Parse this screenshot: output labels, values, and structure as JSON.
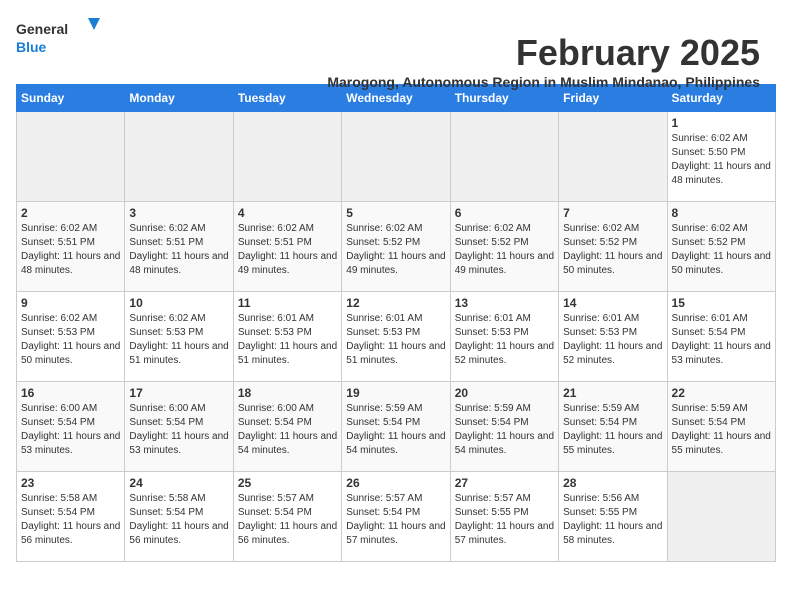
{
  "header": {
    "logo_general": "General",
    "logo_blue": "Blue",
    "month_title": "February 2025",
    "location": "Marogong, Autonomous Region in Muslim Mindanao, Philippines"
  },
  "days_of_week": [
    "Sunday",
    "Monday",
    "Tuesday",
    "Wednesday",
    "Thursday",
    "Friday",
    "Saturday"
  ],
  "weeks": [
    {
      "days": [
        {
          "num": "",
          "empty": true
        },
        {
          "num": "",
          "empty": true
        },
        {
          "num": "",
          "empty": true
        },
        {
          "num": "",
          "empty": true
        },
        {
          "num": "",
          "empty": true
        },
        {
          "num": "",
          "empty": true
        },
        {
          "num": "1",
          "sunrise": "6:02 AM",
          "sunset": "5:50 PM",
          "daylight": "11 hours and 48 minutes."
        }
      ]
    },
    {
      "days": [
        {
          "num": "2",
          "sunrise": "6:02 AM",
          "sunset": "5:51 PM",
          "daylight": "11 hours and 48 minutes."
        },
        {
          "num": "3",
          "sunrise": "6:02 AM",
          "sunset": "5:51 PM",
          "daylight": "11 hours and 48 minutes."
        },
        {
          "num": "4",
          "sunrise": "6:02 AM",
          "sunset": "5:51 PM",
          "daylight": "11 hours and 49 minutes."
        },
        {
          "num": "5",
          "sunrise": "6:02 AM",
          "sunset": "5:52 PM",
          "daylight": "11 hours and 49 minutes."
        },
        {
          "num": "6",
          "sunrise": "6:02 AM",
          "sunset": "5:52 PM",
          "daylight": "11 hours and 49 minutes."
        },
        {
          "num": "7",
          "sunrise": "6:02 AM",
          "sunset": "5:52 PM",
          "daylight": "11 hours and 50 minutes."
        },
        {
          "num": "8",
          "sunrise": "6:02 AM",
          "sunset": "5:52 PM",
          "daylight": "11 hours and 50 minutes."
        }
      ]
    },
    {
      "days": [
        {
          "num": "9",
          "sunrise": "6:02 AM",
          "sunset": "5:53 PM",
          "daylight": "11 hours and 50 minutes."
        },
        {
          "num": "10",
          "sunrise": "6:02 AM",
          "sunset": "5:53 PM",
          "daylight": "11 hours and 51 minutes."
        },
        {
          "num": "11",
          "sunrise": "6:01 AM",
          "sunset": "5:53 PM",
          "daylight": "11 hours and 51 minutes."
        },
        {
          "num": "12",
          "sunrise": "6:01 AM",
          "sunset": "5:53 PM",
          "daylight": "11 hours and 51 minutes."
        },
        {
          "num": "13",
          "sunrise": "6:01 AM",
          "sunset": "5:53 PM",
          "daylight": "11 hours and 52 minutes."
        },
        {
          "num": "14",
          "sunrise": "6:01 AM",
          "sunset": "5:53 PM",
          "daylight": "11 hours and 52 minutes."
        },
        {
          "num": "15",
          "sunrise": "6:01 AM",
          "sunset": "5:54 PM",
          "daylight": "11 hours and 53 minutes."
        }
      ]
    },
    {
      "days": [
        {
          "num": "16",
          "sunrise": "6:00 AM",
          "sunset": "5:54 PM",
          "daylight": "11 hours and 53 minutes."
        },
        {
          "num": "17",
          "sunrise": "6:00 AM",
          "sunset": "5:54 PM",
          "daylight": "11 hours and 53 minutes."
        },
        {
          "num": "18",
          "sunrise": "6:00 AM",
          "sunset": "5:54 PM",
          "daylight": "11 hours and 54 minutes."
        },
        {
          "num": "19",
          "sunrise": "5:59 AM",
          "sunset": "5:54 PM",
          "daylight": "11 hours and 54 minutes."
        },
        {
          "num": "20",
          "sunrise": "5:59 AM",
          "sunset": "5:54 PM",
          "daylight": "11 hours and 54 minutes."
        },
        {
          "num": "21",
          "sunrise": "5:59 AM",
          "sunset": "5:54 PM",
          "daylight": "11 hours and 55 minutes."
        },
        {
          "num": "22",
          "sunrise": "5:59 AM",
          "sunset": "5:54 PM",
          "daylight": "11 hours and 55 minutes."
        }
      ]
    },
    {
      "days": [
        {
          "num": "23",
          "sunrise": "5:58 AM",
          "sunset": "5:54 PM",
          "daylight": "11 hours and 56 minutes."
        },
        {
          "num": "24",
          "sunrise": "5:58 AM",
          "sunset": "5:54 PM",
          "daylight": "11 hours and 56 minutes."
        },
        {
          "num": "25",
          "sunrise": "5:57 AM",
          "sunset": "5:54 PM",
          "daylight": "11 hours and 56 minutes."
        },
        {
          "num": "26",
          "sunrise": "5:57 AM",
          "sunset": "5:54 PM",
          "daylight": "11 hours and 57 minutes."
        },
        {
          "num": "27",
          "sunrise": "5:57 AM",
          "sunset": "5:55 PM",
          "daylight": "11 hours and 57 minutes."
        },
        {
          "num": "28",
          "sunrise": "5:56 AM",
          "sunset": "5:55 PM",
          "daylight": "11 hours and 58 minutes."
        },
        {
          "num": "",
          "empty": true
        }
      ]
    }
  ]
}
